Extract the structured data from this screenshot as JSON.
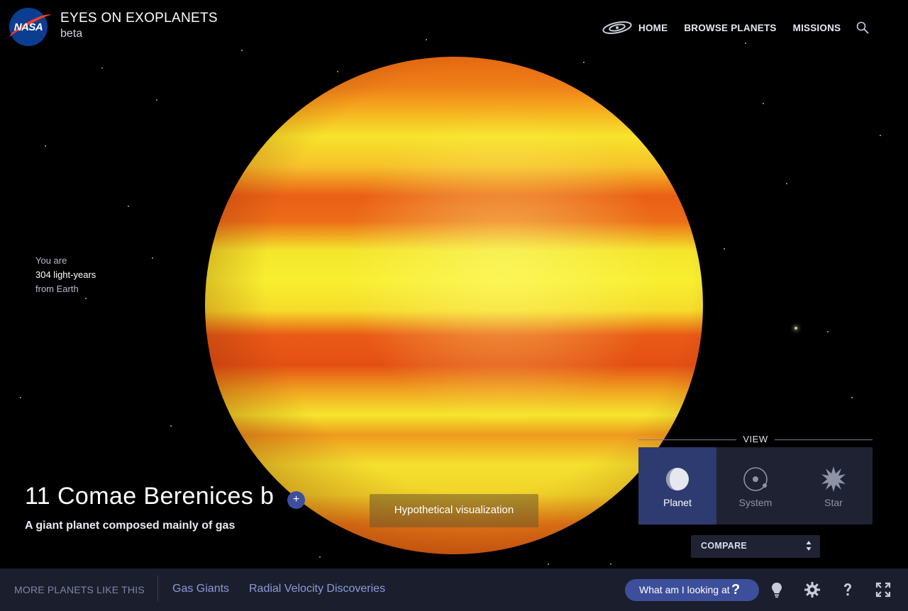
{
  "header": {
    "logo_text": "NASA",
    "title": "EYES ON EXOPLANETS",
    "subtitle": "beta",
    "nav": [
      {
        "label": "HOME",
        "icon": "galaxy-icon"
      },
      {
        "label": "BROWSE PLANETS"
      },
      {
        "label": "MISSIONS"
      }
    ],
    "search_icon": "search-icon"
  },
  "distance": {
    "line1": "You are",
    "value": "304 light-years",
    "line3": "from Earth"
  },
  "planet": {
    "name": "11 Comae Berenices b",
    "add_label": "+",
    "description": "A giant planet composed mainly of gas",
    "visualization_note": "Hypothetical visualization",
    "colors": {
      "band_yellow": "#f6e62e",
      "band_orange": "#e95a16"
    }
  },
  "view": {
    "title": "VIEW",
    "options": [
      {
        "label": "Planet",
        "icon": "planet-icon",
        "active": true
      },
      {
        "label": "System",
        "icon": "system-icon",
        "active": false
      },
      {
        "label": "Star",
        "icon": "star-icon",
        "active": false
      }
    ],
    "compare_label": "COMPARE"
  },
  "bottom": {
    "more_label": "MORE PLANETS LIKE THIS",
    "categories": [
      "Gas Giants",
      "Radial Velocity Discoveries"
    ],
    "what_label": "What am I looking at",
    "what_q": "?",
    "icons": [
      "lightbulb-icon",
      "gear-icon",
      "help-icon",
      "fullscreen-icon"
    ]
  },
  "colors": {
    "accent": "#3d4f9a",
    "panel": "#1f2233",
    "bar": "#1b1e2d"
  }
}
